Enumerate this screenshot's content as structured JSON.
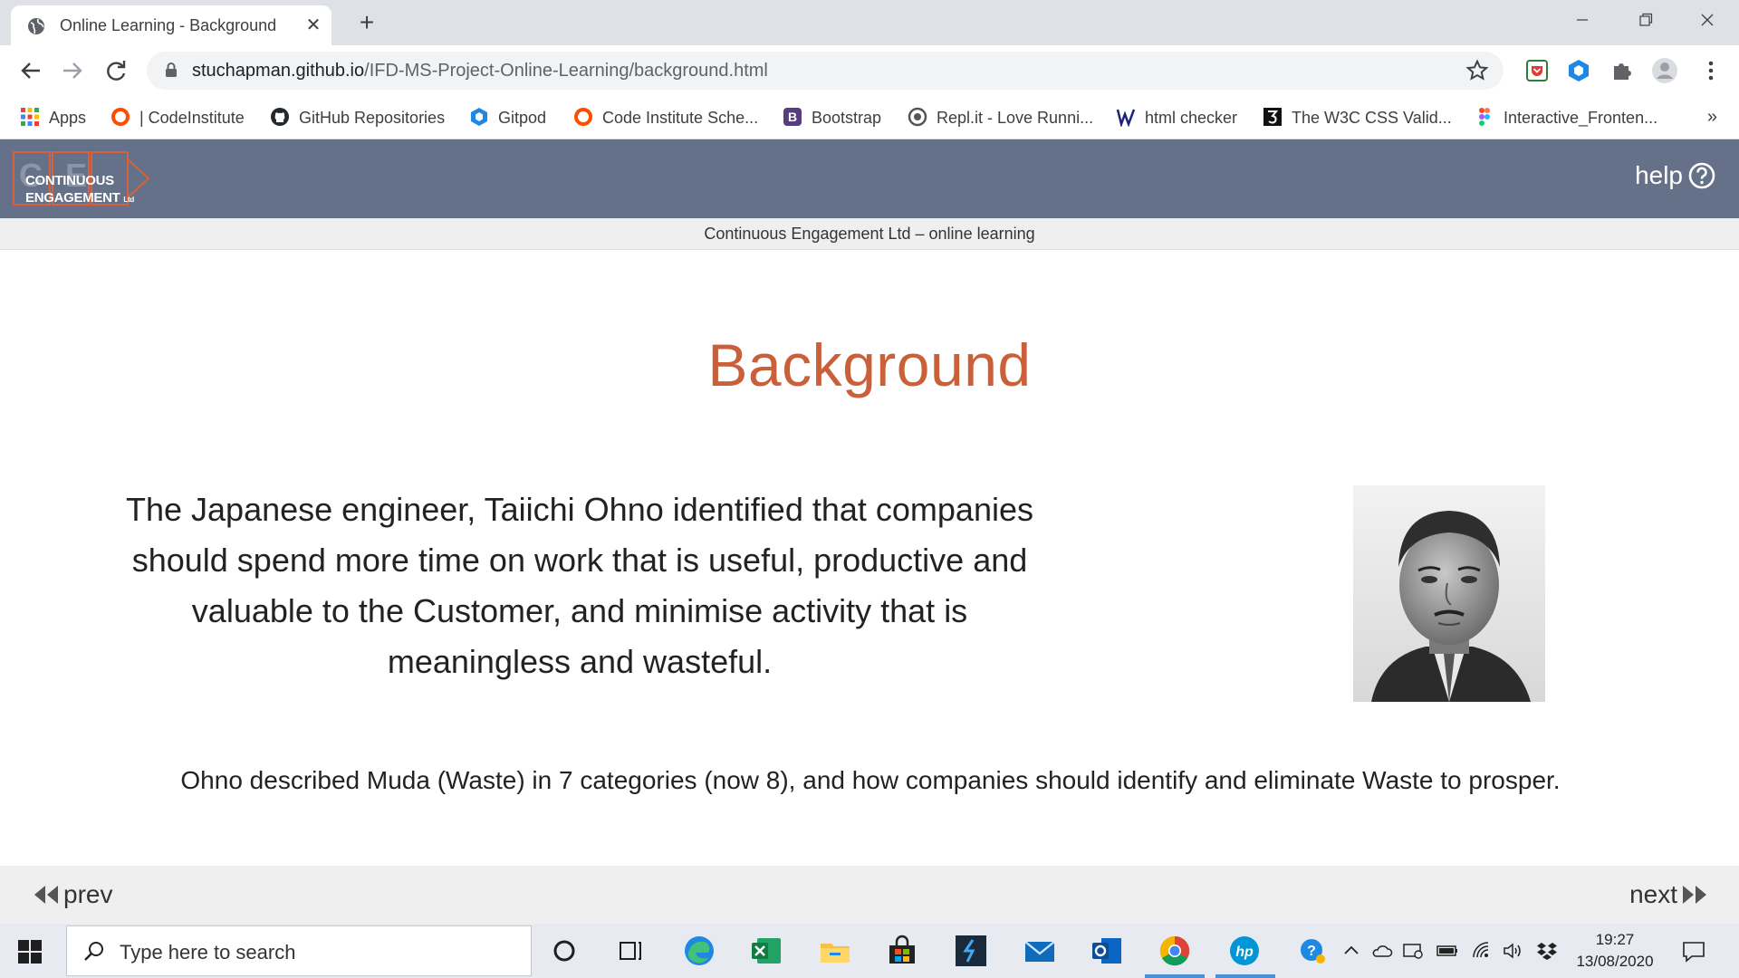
{
  "browser": {
    "tab_title": "Online Learning - Background",
    "tab_close": "✕",
    "new_tab": "+",
    "url_host": "stuchapman.github.io",
    "url_path": "/IFD-MS-Project-Online-Learning/background.html",
    "bookmarks": [
      {
        "label": "Apps",
        "icon": "apps-grid-icon"
      },
      {
        "label": "| CodeInstitute",
        "icon": "code-institute-icon"
      },
      {
        "label": "GitHub Repositories",
        "icon": "github-icon"
      },
      {
        "label": "Gitpod",
        "icon": "gitpod-icon"
      },
      {
        "label": "Code Institute Sche...",
        "icon": "code-institute-icon"
      },
      {
        "label": "Bootstrap",
        "icon": "bootstrap-icon"
      },
      {
        "label": "Repl.it - Love Runni...",
        "icon": "replit-icon"
      },
      {
        "label": "html checker",
        "icon": "w3c-icon"
      },
      {
        "label": "The W3C CSS Valid...",
        "icon": "w3c-css-icon"
      },
      {
        "label": "Interactive_Fronten...",
        "icon": "figma-icon"
      }
    ],
    "bookmarks_more": "»"
  },
  "site": {
    "logo_line1": "CONTINUOUS",
    "logo_line2": "ENGAGEMENT",
    "logo_ltd": "Ltd",
    "help_label": "help",
    "subheader": "Continuous Engagement Ltd – online learning",
    "page_title": "Background",
    "intro": "The Japanese engineer, Taiichi Ohno identified that companies should spend more time on work that is useful, productive and valuable to the Customer, and minimise activity that is meaningless and wasteful.",
    "muda": "Ohno described Muda (Waste) in 7 categories (now 8), and how companies should identify and eliminate Waste to prosper.",
    "prev_label": "prev",
    "next_label": "next",
    "colors": {
      "header_bg": "#647188",
      "title_accent": "#c9603a",
      "logo_orange": "#d9603a"
    }
  },
  "taskbar": {
    "search_placeholder": "Type here to search",
    "time": "19:27",
    "date": "13/08/2020"
  }
}
